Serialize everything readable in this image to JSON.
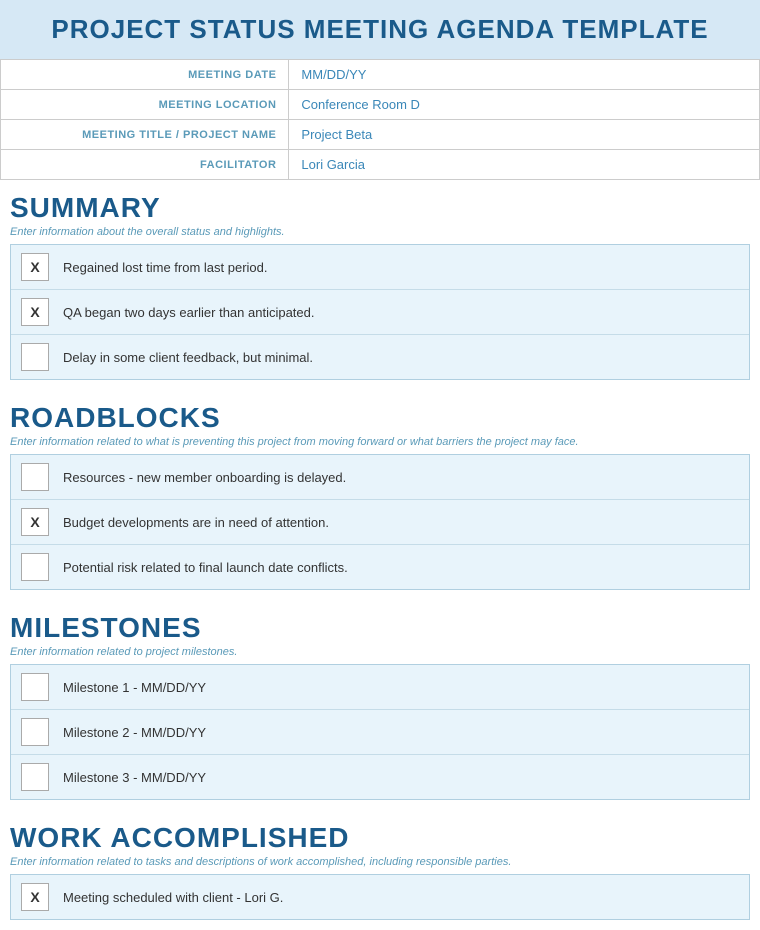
{
  "header": {
    "title": "PROJECT STATUS MEETING AGENDA TEMPLATE"
  },
  "info_fields": [
    {
      "label": "MEETING DATE",
      "value": "MM/DD/YY"
    },
    {
      "label": "MEETING LOCATION",
      "value": "Conference Room D"
    },
    {
      "label": "MEETING TITLE / PROJECT NAME",
      "value": "Project Beta"
    },
    {
      "label": "FACILITATOR",
      "value": "Lori Garcia"
    }
  ],
  "sections": [
    {
      "id": "summary",
      "title": "SUMMARY",
      "subtitle": "Enter information about the overall status and highlights.",
      "items": [
        {
          "checked": true,
          "text": "Regained lost time from last period."
        },
        {
          "checked": true,
          "text": "QA began two days earlier than anticipated."
        },
        {
          "checked": false,
          "text": "Delay in some client feedback, but minimal."
        }
      ]
    },
    {
      "id": "roadblocks",
      "title": "ROADBLOCKS",
      "subtitle": "Enter information related to what is preventing this project from moving forward or what barriers the project may face.",
      "items": [
        {
          "checked": false,
          "text": "Resources - new member onboarding is delayed."
        },
        {
          "checked": true,
          "text": "Budget developments are in need of attention."
        },
        {
          "checked": false,
          "text": "Potential risk related to final launch date conflicts."
        }
      ]
    },
    {
      "id": "milestones",
      "title": "MILESTONES",
      "subtitle": "Enter information related to project milestones.",
      "items": [
        {
          "checked": false,
          "text": "Milestone 1 - MM/DD/YY"
        },
        {
          "checked": false,
          "text": "Milestone 2 - MM/DD/YY"
        },
        {
          "checked": false,
          "text": "Milestone 3 - MM/DD/YY"
        }
      ]
    },
    {
      "id": "work-accomplished",
      "title": "WORK ACCOMPLISHED",
      "subtitle": "Enter information related to tasks and descriptions of work accomplished, including responsible parties.",
      "items": [
        {
          "checked": true,
          "text": "Meeting scheduled with client - Lori G."
        }
      ]
    }
  ],
  "checkbox_mark": "X"
}
